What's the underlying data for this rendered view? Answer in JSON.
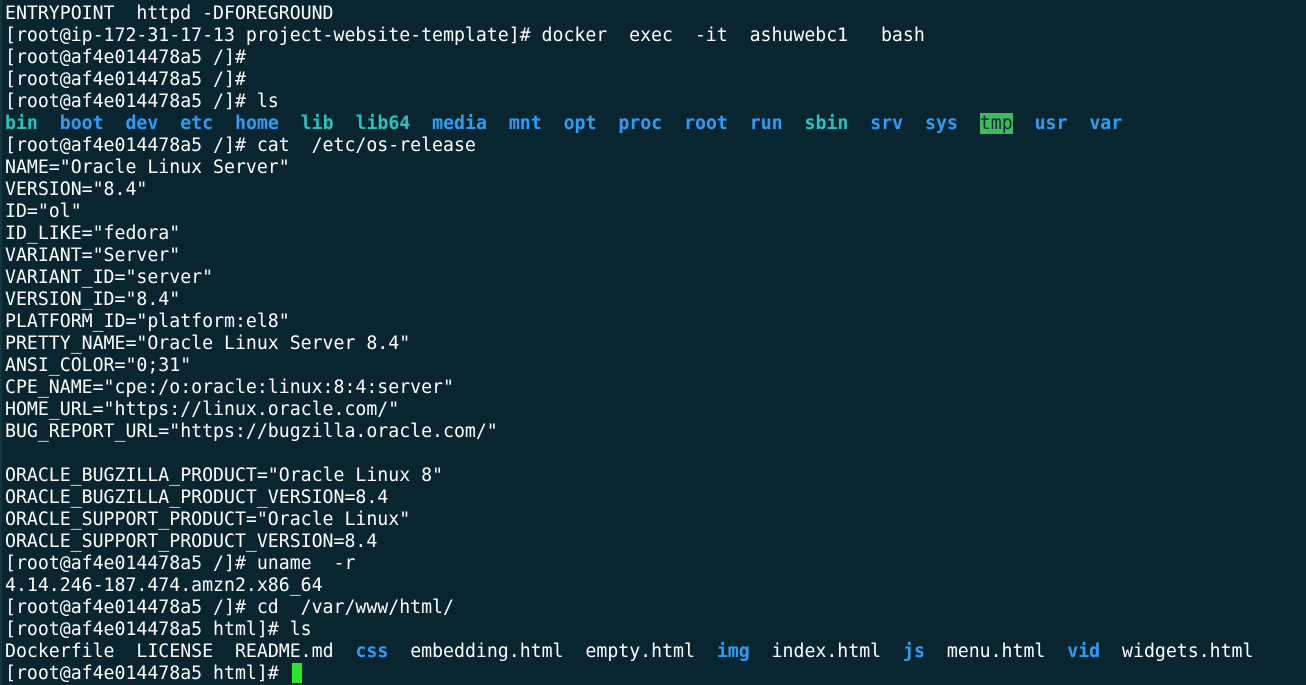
{
  "colors": {
    "background": "#092630",
    "text": "#ffffff",
    "dir_blue": "#2f9df5",
    "dir_cyan": "#27c3c0",
    "dir_tmp_bg": "#3cbc5a",
    "cursor": "#28e62c"
  },
  "lines": [
    "ENTRYPOINT  httpd -DFOREGROUND",
    "[root@ip-172-31-17-13 project-website-template]# docker  exec  -it  ashuwebc1   bash",
    "[root@af4e014478a5 /]#",
    "[root@af4e014478a5 /]#",
    "[root@af4e014478a5 /]# ls"
  ],
  "root_listing": [
    {
      "name": "bin",
      "color": "cyan"
    },
    {
      "name": "boot",
      "color": "blue"
    },
    {
      "name": "dev",
      "color": "blue"
    },
    {
      "name": "etc",
      "color": "blue"
    },
    {
      "name": "home",
      "color": "blue"
    },
    {
      "name": "lib",
      "color": "cyan"
    },
    {
      "name": "lib64",
      "color": "cyan"
    },
    {
      "name": "media",
      "color": "blue"
    },
    {
      "name": "mnt",
      "color": "blue"
    },
    {
      "name": "opt",
      "color": "blue"
    },
    {
      "name": "proc",
      "color": "blue"
    },
    {
      "name": "root",
      "color": "blue"
    },
    {
      "name": "run",
      "color": "blue"
    },
    {
      "name": "sbin",
      "color": "cyan"
    },
    {
      "name": "srv",
      "color": "blue"
    },
    {
      "name": "sys",
      "color": "blue"
    },
    {
      "name": "tmp",
      "color": "tmp"
    },
    {
      "name": "usr",
      "color": "blue"
    },
    {
      "name": "var",
      "color": "blue"
    }
  ],
  "os_release_cmd": "[root@af4e014478a5 /]# cat  /etc/os-release",
  "os_release": [
    "NAME=\"Oracle Linux Server\"",
    "VERSION=\"8.4\"",
    "ID=\"ol\"",
    "ID_LIKE=\"fedora\"",
    "VARIANT=\"Server\"",
    "VARIANT_ID=\"server\"",
    "VERSION_ID=\"8.4\"",
    "PLATFORM_ID=\"platform:el8\"",
    "PRETTY_NAME=\"Oracle Linux Server 8.4\"",
    "ANSI_COLOR=\"0;31\"",
    "CPE_NAME=\"cpe:/o:oracle:linux:8:4:server\"",
    "HOME_URL=\"https://linux.oracle.com/\"",
    "BUG_REPORT_URL=\"https://bugzilla.oracle.com/\""
  ],
  "oracle_info": [
    "ORACLE_BUGZILLA_PRODUCT=\"Oracle Linux 8\"",
    "ORACLE_BUGZILLA_PRODUCT_VERSION=8.4",
    "ORACLE_SUPPORT_PRODUCT=\"Oracle Linux\"",
    "ORACLE_SUPPORT_PRODUCT_VERSION=8.4"
  ],
  "uname_cmd": "[root@af4e014478a5 /]# uname  -r",
  "uname_out": "4.14.246-187.474.amzn2.x86_64",
  "cd_cmd": "[root@af4e014478a5 /]# cd  /var/www/html/",
  "ls_html_cmd": "[root@af4e014478a5 html]# ls",
  "html_listing": [
    {
      "name": "Dockerfile",
      "color": "plain"
    },
    {
      "name": "LICENSE",
      "color": "plain"
    },
    {
      "name": "README.md",
      "color": "plain"
    },
    {
      "name": "css",
      "color": "blue"
    },
    {
      "name": "embedding.html",
      "color": "plain"
    },
    {
      "name": "empty.html",
      "color": "plain"
    },
    {
      "name": "img",
      "color": "blue"
    },
    {
      "name": "index.html",
      "color": "plain"
    },
    {
      "name": "js",
      "color": "blue"
    },
    {
      "name": "menu.html",
      "color": "plain"
    },
    {
      "name": "vid",
      "color": "blue"
    },
    {
      "name": "widgets.html",
      "color": "plain"
    }
  ],
  "final_prompt": "[root@af4e014478a5 html]# "
}
